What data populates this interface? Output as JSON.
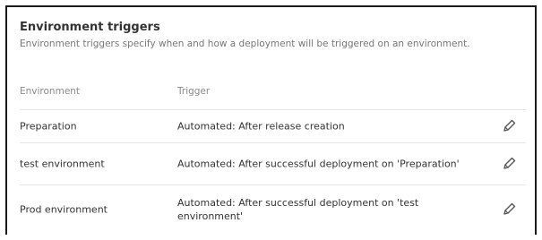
{
  "section": {
    "title": "Environment triggers",
    "description": "Environment triggers specify when and how a deployment will be triggered on an environment."
  },
  "table": {
    "headers": {
      "environment": "Environment",
      "trigger": "Trigger"
    },
    "rows": [
      {
        "environment": "Preparation",
        "trigger": "Automated: After release creation",
        "edit_icon": "pencil-icon"
      },
      {
        "environment": "test environment",
        "trigger": "Automated: After successful deployment on 'Preparation'",
        "edit_icon": "pencil-icon"
      },
      {
        "environment": "Prod environment",
        "trigger": "Automated: After successful deployment on 'test environment'",
        "edit_icon": "pencil-icon"
      }
    ]
  },
  "colors": {
    "frame_border": "#1a1a1a",
    "title_text": "#333333",
    "muted_text": "#777777",
    "row_divider": "#e6e6e6"
  }
}
